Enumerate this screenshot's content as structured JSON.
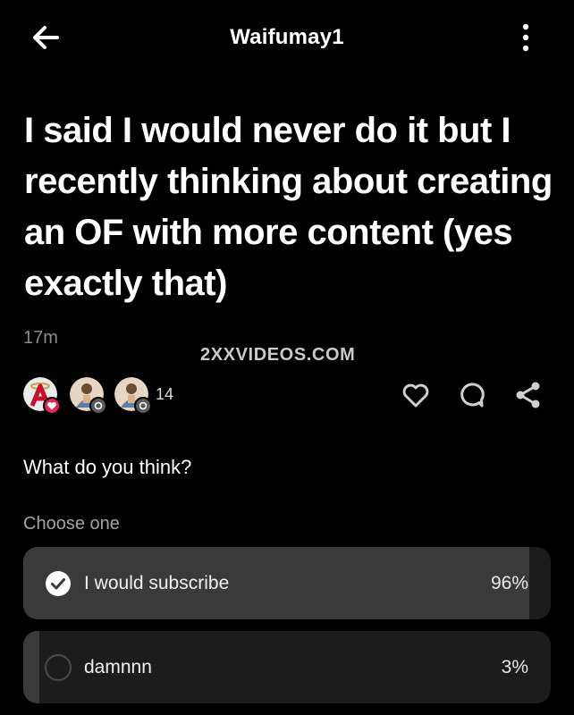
{
  "header": {
    "title": "Waifumay1",
    "back_icon": "arrow-left-icon",
    "more_icon": "more-vertical-icon"
  },
  "post": {
    "title": "I said I would never do it but I recently thinking about creating an OF with more content (yes exactly that)",
    "time": "17m",
    "watermark": "2XXVIDEOS.COM",
    "reaction_count": "14",
    "actions": [
      "heart-icon",
      "comment-icon",
      "share-icon"
    ]
  },
  "poll": {
    "question": "What do you think?",
    "instruction": "Choose one",
    "options": [
      {
        "label": "I would subscribe",
        "percent": "96%",
        "share": 0.96,
        "selected": true
      },
      {
        "label": "damnnn",
        "percent": "3%",
        "share": 0.03,
        "selected": false
      }
    ]
  },
  "colors": {
    "background": "#000000",
    "option_bg": "#1c1c1c",
    "option_fill": "#3a3a3a",
    "muted_text": "#8c8c8c",
    "like_badge": "#e0245e"
  }
}
